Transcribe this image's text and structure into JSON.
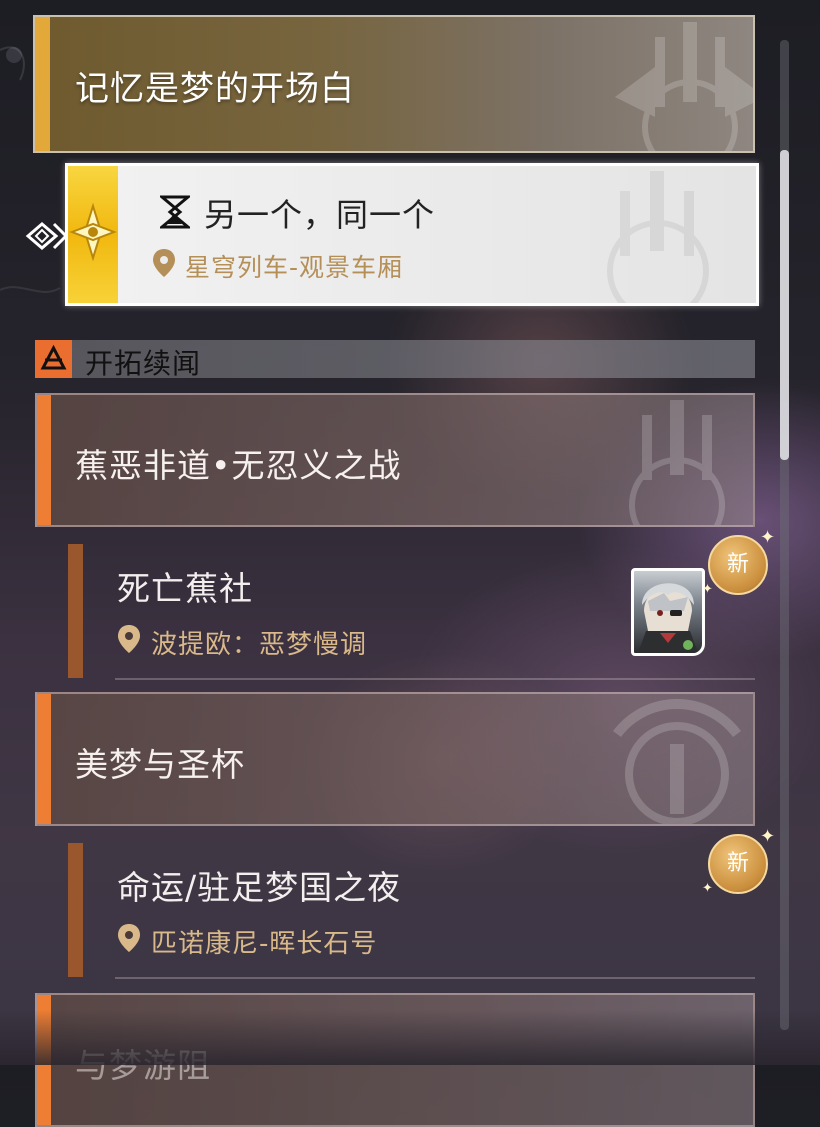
{
  "main_quest": {
    "chapter_title": "记忆是梦的开场白",
    "selected": {
      "title": "另一个，同一个",
      "location": "星穹列车-观景车厢",
      "icon": "hourglass-icon"
    }
  },
  "section": {
    "label": "开拓续闻",
    "icon": "trailblaze-icon"
  },
  "groups": [
    {
      "title": "蕉恶非道•无忍义之战",
      "quest": {
        "title": "死亡蕉社",
        "location": "波提欧：恶梦慢调",
        "badge": "新",
        "has_avatar": true
      }
    },
    {
      "title": "美梦与圣杯",
      "quest": {
        "title": "命运/驻足梦国之夜",
        "location": "匹诺康尼-晖长石号",
        "badge": "新"
      }
    },
    {
      "title": "与梦游阻"
    }
  ],
  "colors": {
    "gold_accent": "#e2a93a",
    "orange_accent": "#ed7e33",
    "quest_bar": "#9a572e",
    "location_text": "#d9b98a"
  }
}
